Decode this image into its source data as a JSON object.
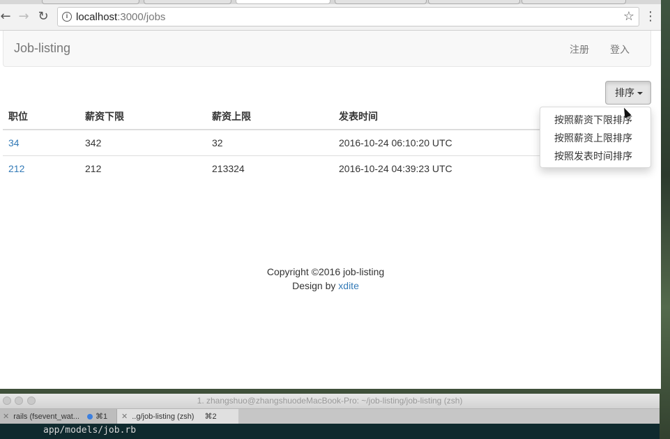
{
  "browser": {
    "url_host": "localhost",
    "url_path": ":3000/jobs"
  },
  "navbar": {
    "brand": "Job-listing",
    "register": "注册",
    "login": "登入"
  },
  "sort": {
    "label": "排序",
    "options": [
      "按照薪资下限排序",
      "按照薪资上限排序",
      "按照发表时间排序"
    ]
  },
  "table": {
    "headers": [
      "职位",
      "薪资下限",
      "薪资上限",
      "发表时间"
    ],
    "rows": [
      {
        "title": "34",
        "wage_lower": "342",
        "wage_upper": "32",
        "created_at": "2016-10-24 06:10:20 UTC"
      },
      {
        "title": "212",
        "wage_lower": "212",
        "wage_upper": "213324",
        "created_at": "2016-10-24 04:39:23 UTC"
      }
    ]
  },
  "footer": {
    "copyright": "Copyright ©2016 job-listing",
    "design_by": "Design by ",
    "designer": "xdite"
  },
  "terminal": {
    "title": "1. zhangshuo@zhangshuodeMacBook-Pro: ~/job-listing/job-listing (zsh)",
    "tab1": "rails (fsevent_wat...",
    "tab1_shortcut": "⌘1",
    "tab2": "..g/job-listing (zsh)",
    "tab2_shortcut": "⌘2",
    "line": "app/models/job.rb"
  },
  "colors": {
    "link": "#337ab7",
    "terminal_bg": "#0f2a2e"
  }
}
